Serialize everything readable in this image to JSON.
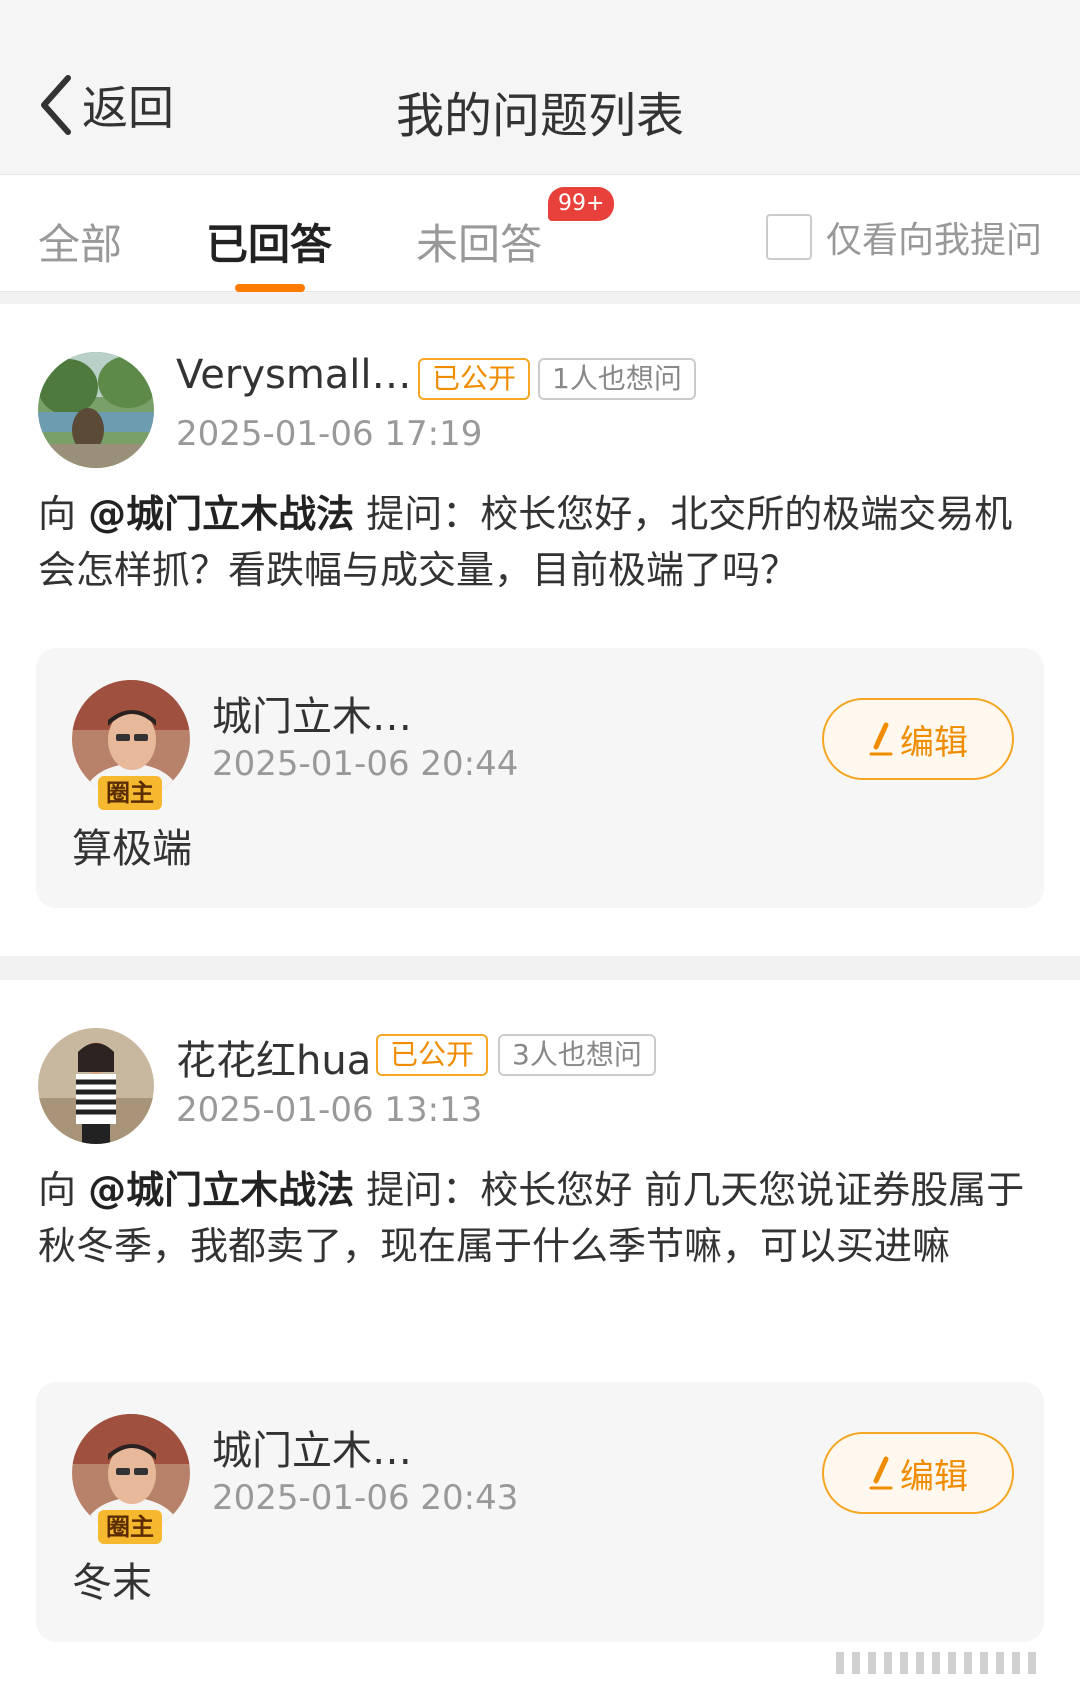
{
  "header": {
    "back_label": "返回",
    "title": "我的问题列表",
    "back_icon": "chevron-left-icon"
  },
  "tabs": [
    {
      "label": "全部",
      "active": false
    },
    {
      "label": "已回答",
      "active": true
    },
    {
      "label": "未回答",
      "active": false,
      "badge": "99+"
    }
  ],
  "filter": {
    "label": "仅看向我提问",
    "checked": false
  },
  "questions": [
    {
      "asker": "Verysmall…",
      "visibility_tag": "已公开",
      "also_ask": "1人也想问",
      "time": "2025-01-06 17:19",
      "prefix": "向 ",
      "mention": "@城门立木战法",
      "text": " 提问：校长您好，北交所的极端交易机会怎样抓？看跌幅与成交量，目前极端了吗？",
      "answer": {
        "name": "城门立木…",
        "role_badge": "圈主",
        "time": "2025-01-06 20:44",
        "text": "算极端",
        "edit_label": "编辑"
      }
    },
    {
      "asker": "花花红hua",
      "visibility_tag": "已公开",
      "also_ask": "3人也想问",
      "time": "2025-01-06 13:13",
      "prefix": "向 ",
      "mention": "@城门立木战法",
      "text": " 提问：校长您好 前几天您说证券股属于秋冬季，我都卖了，现在属于什么季节嘛，可以买进嘛",
      "answer": {
        "name": "城门立木…",
        "role_badge": "圈主",
        "time": "2025-01-06 20:43",
        "text": "冬末",
        "edit_label": "编辑"
      }
    }
  ],
  "colors": {
    "accent": "#ff7a00",
    "badge": "#e8403a",
    "owner_badge": "#f5b82e"
  }
}
